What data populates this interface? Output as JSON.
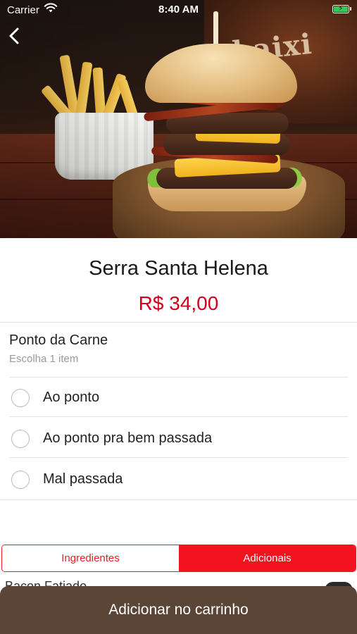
{
  "status_bar": {
    "carrier": "Carrier",
    "time": "8:40 AM"
  },
  "hero": {
    "sign_text": "baixi"
  },
  "product": {
    "name": "Serra Santa Helena",
    "price": "R$ 34,00"
  },
  "section": {
    "title": "Ponto da Carne",
    "subtitle": "Escolha 1 item",
    "options": [
      {
        "label": "Ao ponto"
      },
      {
        "label": "Ao ponto pra bem passada"
      },
      {
        "label": "Mal passada"
      }
    ]
  },
  "tabs": {
    "ingredientes": "Ingredientes",
    "adicionais": "Adicionais",
    "selected": "Adicionais"
  },
  "list_peek": {
    "first_item": "Bacon Fatiado"
  },
  "cart_button": {
    "label": "Adicionar no carrinho"
  },
  "colors": {
    "accent_red": "#ee1b24",
    "price_red": "#d0021b",
    "cart_bar": "#5a4536",
    "battery_green": "#34c759"
  }
}
